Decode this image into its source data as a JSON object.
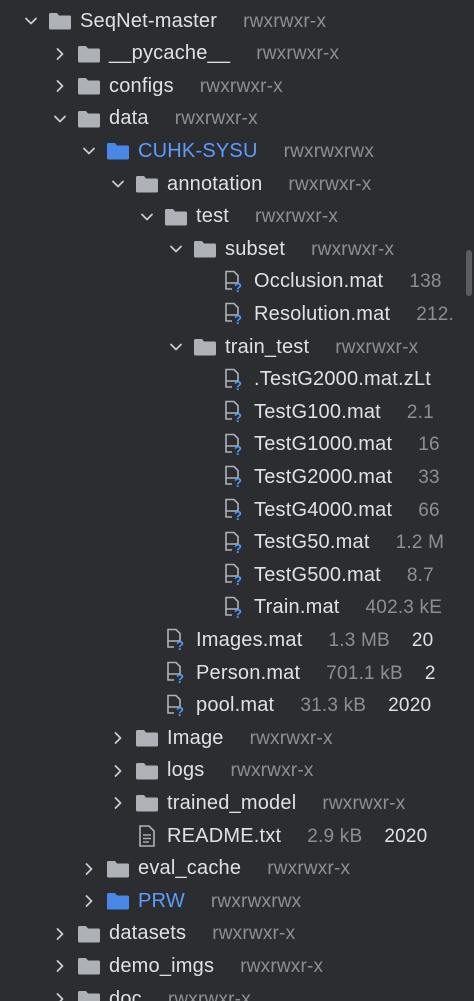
{
  "tree": [
    {
      "name": "SeqNet-master",
      "meta": "rwxrwxr-x",
      "depth": 0,
      "arrow": "down",
      "icon": "folder-icon"
    },
    {
      "name": "__pycache__",
      "meta": "rwxrwxr-x",
      "depth": 1,
      "arrow": "right",
      "icon": "folder-icon"
    },
    {
      "name": "configs",
      "meta": "rwxrwxr-x",
      "depth": 1,
      "arrow": "right",
      "icon": "folder-icon"
    },
    {
      "name": "data",
      "meta": "rwxrwxr-x",
      "depth": 1,
      "arrow": "down",
      "icon": "folder-icon"
    },
    {
      "name": "CUHK-SYSU",
      "meta": "rwxrwxrwx",
      "depth": 2,
      "arrow": "down",
      "icon": "folder-icon",
      "highlight": true
    },
    {
      "name": "annotation",
      "meta": "rwxrwxr-x",
      "depth": 3,
      "arrow": "down",
      "icon": "folder-icon"
    },
    {
      "name": "test",
      "meta": "rwxrwxr-x",
      "depth": 4,
      "arrow": "down",
      "icon": "folder-icon"
    },
    {
      "name": "subset",
      "meta": "rwxrwxr-x",
      "depth": 5,
      "arrow": "down",
      "icon": "folder-icon"
    },
    {
      "name": "Occlusion.mat",
      "meta": "138",
      "depth": 6,
      "arrow": "none",
      "icon": "unknown-file-icon"
    },
    {
      "name": "Resolution.mat",
      "meta": "212.",
      "depth": 6,
      "arrow": "none",
      "icon": "unknown-file-icon"
    },
    {
      "name": "train_test",
      "meta": "rwxrwxr-x",
      "depth": 5,
      "arrow": "down",
      "icon": "folder-icon"
    },
    {
      "name": ".TestG2000.mat.zLt",
      "meta": "",
      "depth": 6,
      "arrow": "none",
      "icon": "unknown-file-icon"
    },
    {
      "name": "TestG100.mat",
      "meta": "2.1",
      "depth": 6,
      "arrow": "none",
      "icon": "unknown-file-icon"
    },
    {
      "name": "TestG1000.mat",
      "meta": "16",
      "depth": 6,
      "arrow": "none",
      "icon": "unknown-file-icon"
    },
    {
      "name": "TestG2000.mat",
      "meta": "33",
      "depth": 6,
      "arrow": "none",
      "icon": "unknown-file-icon"
    },
    {
      "name": "TestG4000.mat",
      "meta": "66",
      "depth": 6,
      "arrow": "none",
      "icon": "unknown-file-icon"
    },
    {
      "name": "TestG50.mat",
      "meta": "1.2 M",
      "depth": 6,
      "arrow": "none",
      "icon": "unknown-file-icon"
    },
    {
      "name": "TestG500.mat",
      "meta": "8.7",
      "depth": 6,
      "arrow": "none",
      "icon": "unknown-file-icon"
    },
    {
      "name": "Train.mat",
      "meta": "402.3 kE",
      "depth": 6,
      "arrow": "none",
      "icon": "unknown-file-icon"
    },
    {
      "name": "Images.mat",
      "meta": "1.3 MB",
      "meta2": "20",
      "depth": 4,
      "arrow": "none",
      "icon": "unknown-file-icon"
    },
    {
      "name": "Person.mat",
      "meta": "701.1 kB",
      "meta2": "2",
      "depth": 4,
      "arrow": "none",
      "icon": "unknown-file-icon"
    },
    {
      "name": "pool.mat",
      "meta": "31.3 kB",
      "meta2": "2020",
      "depth": 4,
      "arrow": "none",
      "icon": "unknown-file-icon"
    },
    {
      "name": "Image",
      "meta": "rwxrwxr-x",
      "depth": 3,
      "arrow": "right",
      "icon": "folder-icon"
    },
    {
      "name": "logs",
      "meta": "rwxrwxr-x",
      "depth": 3,
      "arrow": "right",
      "icon": "folder-icon"
    },
    {
      "name": "trained_model",
      "meta": "rwxrwxr-x",
      "depth": 3,
      "arrow": "right",
      "icon": "folder-icon"
    },
    {
      "name": "README.txt",
      "meta": "2.9 kB",
      "meta2": "2020",
      "depth": 3,
      "arrow": "none",
      "icon": "text-file-icon"
    },
    {
      "name": "eval_cache",
      "meta": "rwxrwxr-x",
      "depth": 2,
      "arrow": "right",
      "icon": "folder-icon"
    },
    {
      "name": "PRW",
      "meta": "rwxrwxrwx",
      "depth": 2,
      "arrow": "right",
      "icon": "folder-icon",
      "highlight": true
    },
    {
      "name": "datasets",
      "meta": "rwxrwxr-x",
      "depth": 1,
      "arrow": "right",
      "icon": "folder-icon"
    },
    {
      "name": "demo_imgs",
      "meta": "rwxrwxr-x",
      "depth": 1,
      "arrow": "right",
      "icon": "folder-icon"
    },
    {
      "name": "doc",
      "meta": "rwxrwxr-x",
      "depth": 1,
      "arrow": "right",
      "icon": "folder-icon"
    }
  ]
}
